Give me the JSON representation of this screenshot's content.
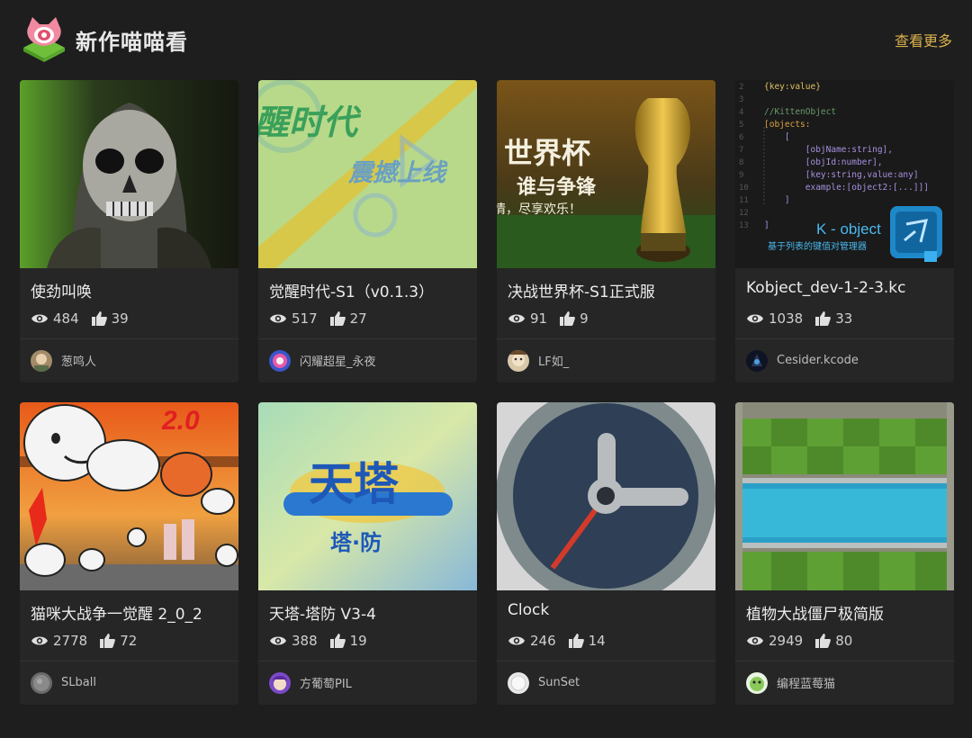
{
  "header": {
    "title": "新作喵喵看",
    "more_label": "查看更多",
    "accent_color": "#d9b14c"
  },
  "cards": [
    {
      "title": "使劲叫唤",
      "views": "484",
      "likes": "39",
      "author": "葱鸣人"
    },
    {
      "title": "觉醒时代-S1（v0.1.3）",
      "views": "517",
      "likes": "27",
      "author": "闪耀超星_永夜",
      "thumb_text": [
        "醒时代",
        "震撼上线"
      ]
    },
    {
      "title": "决战世界杯-S1正式服",
      "views": "91",
      "likes": "9",
      "author": "LF如_",
      "thumb_text": [
        "世界杯",
        "谁与争锋",
        "情，尽享欢乐！"
      ]
    },
    {
      "title": "Kobject_dev-1-2-3.kc",
      "views": "1038",
      "likes": "33",
      "author": "Cesider.kcode",
      "thumb_text": {
        "lines": [
          "{key:value}",
          "",
          "//KittenObject",
          "[objects:",
          "    [",
          "        [objName:string],",
          "        [objId:number],",
          "        [key:string,value:any]",
          "        example:[object2:[...]]]",
          "    ]",
          "",
          "]",
          ""
        ],
        "line_numbers": [
          "2",
          "3",
          "4",
          "5",
          "6",
          "7",
          "8",
          "9",
          "10",
          "11",
          "12",
          "13"
        ],
        "brand": "K - object",
        "tagline": "基于列表的键值对管理器"
      }
    },
    {
      "title": "猫咪大战争一觉醒 2_0_2",
      "views": "2778",
      "likes": "72",
      "author": "SLball",
      "thumb_text": [
        "2.0"
      ]
    },
    {
      "title": "天塔-塔防 V3-4",
      "views": "388",
      "likes": "19",
      "author": "方葡萄PIL",
      "thumb_text": [
        "天塔",
        "塔·防"
      ]
    },
    {
      "title": "Clock",
      "views": "246",
      "likes": "14",
      "author": "SunSet"
    },
    {
      "title": "植物大战僵尸极简版",
      "views": "2949",
      "likes": "80",
      "author": "编程蓝莓猫"
    }
  ]
}
